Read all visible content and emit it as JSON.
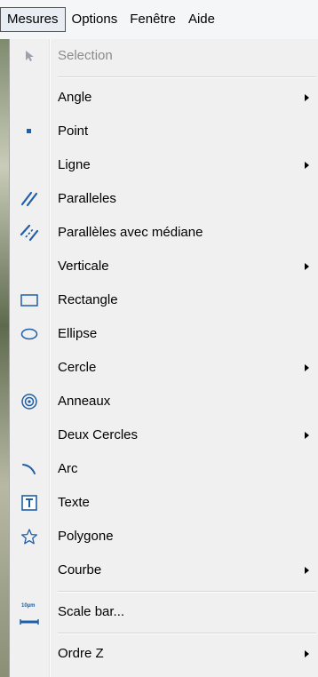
{
  "menubar": {
    "items": [
      {
        "label": "Mesures",
        "active": true
      },
      {
        "label": "Options"
      },
      {
        "label": "Fenêtre"
      },
      {
        "label": "Aide"
      }
    ]
  },
  "menu": {
    "items": [
      {
        "label": "Selection",
        "icon": "cursor-icon",
        "disabled": true,
        "submenu": false
      },
      {
        "separator": true
      },
      {
        "label": "Angle",
        "icon": null,
        "submenu": true
      },
      {
        "label": "Point",
        "icon": "point-icon",
        "submenu": false
      },
      {
        "label": "Ligne",
        "icon": null,
        "submenu": true
      },
      {
        "label": "Paralleles",
        "icon": "parallel-lines-icon",
        "submenu": false
      },
      {
        "label": "Parallèles avec médiane",
        "icon": "parallel-median-icon",
        "submenu": false
      },
      {
        "label": "Verticale",
        "icon": null,
        "submenu": true
      },
      {
        "label": "Rectangle",
        "icon": "rectangle-icon",
        "submenu": false
      },
      {
        "label": "Ellipse",
        "icon": "ellipse-icon",
        "submenu": false
      },
      {
        "label": "Cercle",
        "icon": null,
        "submenu": true
      },
      {
        "label": "Anneaux",
        "icon": "rings-icon",
        "submenu": false
      },
      {
        "label": "Deux Cercles",
        "icon": null,
        "submenu": true
      },
      {
        "label": "Arc",
        "icon": "arc-icon",
        "submenu": false
      },
      {
        "label": "Texte",
        "icon": "text-icon",
        "submenu": false
      },
      {
        "label": "Polygone",
        "icon": "polygon-icon",
        "submenu": false
      },
      {
        "label": "Courbe",
        "icon": null,
        "submenu": true
      },
      {
        "separator": true
      },
      {
        "label": "Scale bar...",
        "icon": "scale-bar-icon",
        "icon_text": "10µm",
        "submenu": false
      },
      {
        "separator": true
      },
      {
        "label": "Ordre Z",
        "icon": null,
        "submenu": true
      }
    ]
  },
  "colors": {
    "icon_blue": "#1f5fa8",
    "disabled_text": "#8b8b8b",
    "menu_bg": "#f0f0f0"
  }
}
